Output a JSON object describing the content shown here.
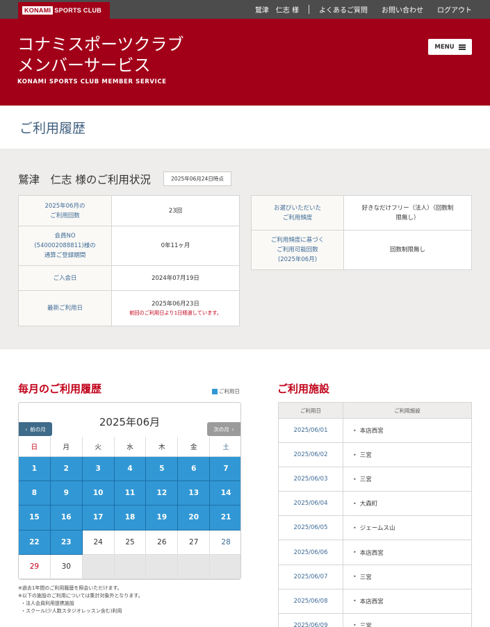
{
  "header": {
    "logo_mark": "KONAMI",
    "logo_text": "SPORTS CLUB",
    "user": "鷲津　仁志 様",
    "links": [
      "よくあるご質問",
      "お問い合わせ",
      "ログアウト"
    ]
  },
  "hero": {
    "title_line1": "コナミスポーツクラブ",
    "title_line2": "メンバーサービス",
    "subtitle": "KONAMI SPORTS CLUB MEMBER SERVICE",
    "menu_label": "MENU"
  },
  "page_title": "ご利用履歴",
  "status": {
    "heading": "鷲津　仁志 様のご利用状況",
    "as_of": "2025年06月24日時点",
    "left": {
      "monthly_label_1": "2025年06月の",
      "monthly_label_2": "ご利用回数",
      "monthly_value": "23回",
      "member_label_1": "会員NO",
      "member_label_2": "(540002088811)様の",
      "member_label_3": "通算ご登録期間",
      "member_value": "0年11ヶ月",
      "join_label": "ご入会日",
      "join_value": "2024年07月19日",
      "last_label": "最新ご利用日",
      "last_value": "2025年06月23日",
      "last_note": "前回のご利用日より1日経過しています。"
    },
    "right": {
      "freq_label_1": "お選びいただいた",
      "freq_label_2": "ご利用頻度",
      "freq_value_1": "好きなだけフリー（法人）（回数制",
      "freq_value_2": "限無し）",
      "avail_label_1": "ご利用頻度に基づく",
      "avail_label_2": "ご利用可能回数",
      "avail_label_3": "(2025年06月)",
      "avail_value": "回数制限無し"
    }
  },
  "monthly": {
    "title": "毎月のご利用履歴",
    "legend": "ご利用日",
    "calendar": {
      "month": "2025年06月",
      "prev": "前の月",
      "next": "次の月",
      "weekdays": [
        "日",
        "月",
        "火",
        "水",
        "木",
        "金",
        "土"
      ],
      "used_days": [
        1,
        2,
        3,
        4,
        5,
        6,
        7,
        8,
        9,
        10,
        11,
        12,
        13,
        14,
        15,
        16,
        17,
        18,
        19,
        20,
        21,
        22,
        23
      ],
      "days_in_month": 30,
      "first_weekday": 0
    },
    "notes": [
      "※過去1年間のご利用履歴を照会いただけます。",
      "※以下の施設のご利用については集計対象外となります。",
      "・法人会員利用提携施設",
      "・スクール(少人数スタジオレッスン含む)利用"
    ]
  },
  "facilities": {
    "title": "ご利用施設",
    "col_date": "ご利用日",
    "col_facility": "ご利用施設",
    "rows": [
      {
        "date": "2025/06/01",
        "facility": "本店西宮"
      },
      {
        "date": "2025/06/02",
        "facility": "三宮"
      },
      {
        "date": "2025/06/03",
        "facility": "三宮"
      },
      {
        "date": "2025/06/04",
        "facility": "大森町"
      },
      {
        "date": "2025/06/05",
        "facility": "ジェームス山"
      },
      {
        "date": "2025/06/06",
        "facility": "本店西宮"
      },
      {
        "date": "2025/06/07",
        "facility": "三宮"
      },
      {
        "date": "2025/06/08",
        "facility": "本店西宮"
      },
      {
        "date": "2025/06/09",
        "facility": "三宮"
      }
    ]
  },
  "colors": {
    "brand_red": "#a20019",
    "used_blue": "#3298d5",
    "topbar": "#4c4c4c"
  }
}
